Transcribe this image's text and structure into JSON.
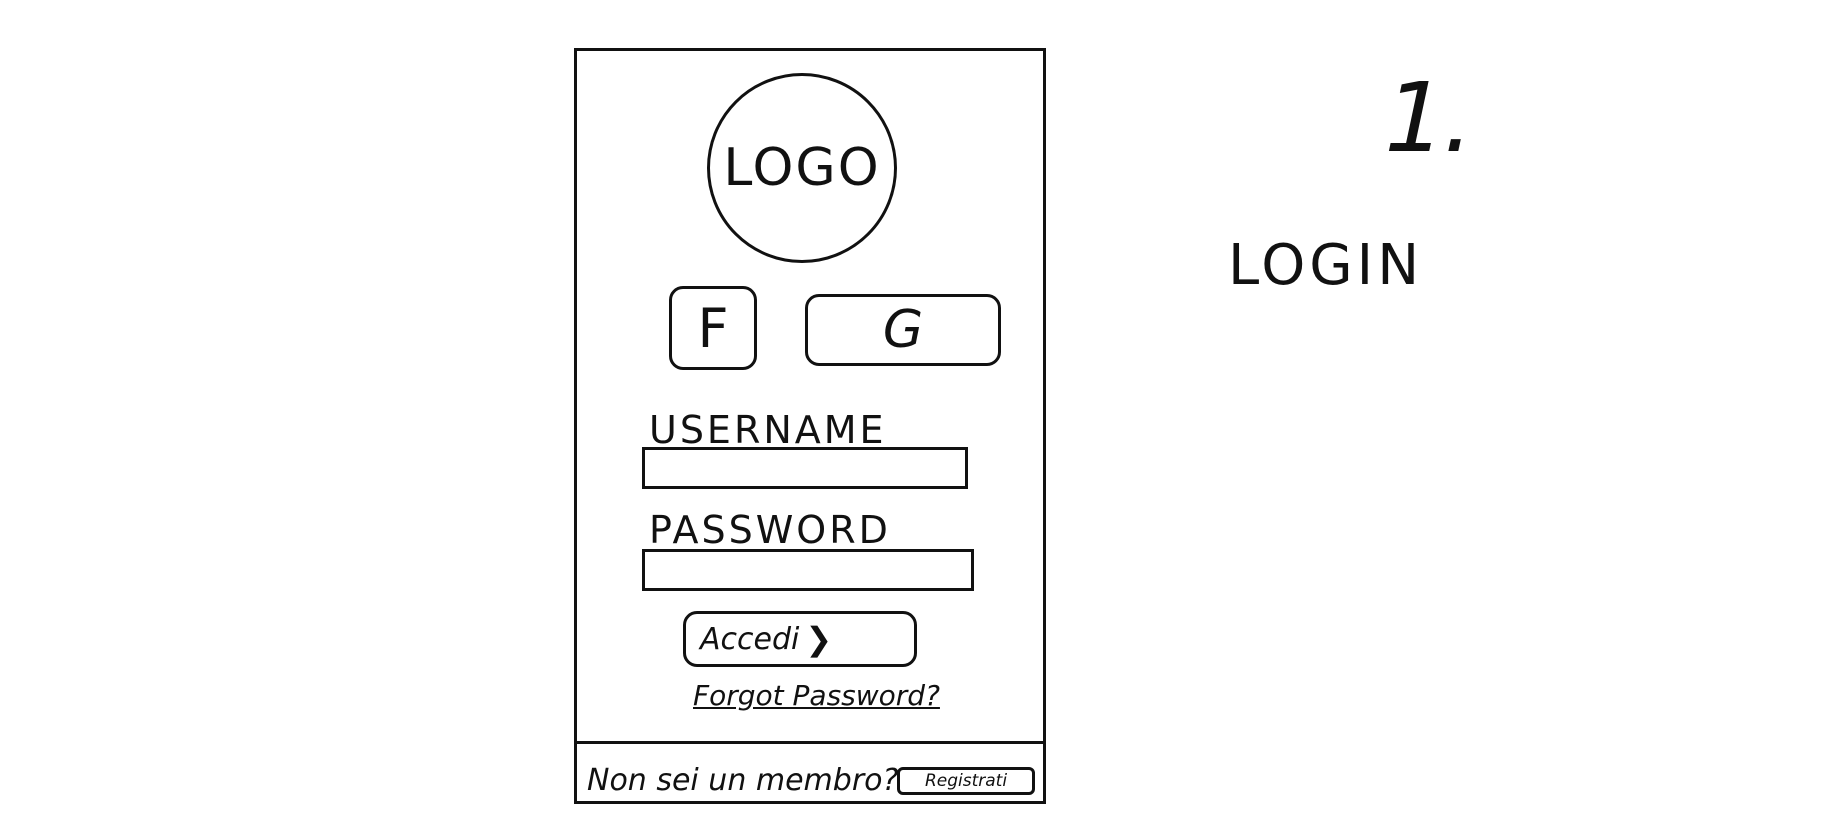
{
  "logo": {
    "label": "LOGO"
  },
  "social": {
    "facebook_label": "F",
    "google_label": "G"
  },
  "form": {
    "username_label": "USERNAME",
    "username_value": "",
    "password_label": "PASSWORD",
    "password_value": "",
    "submit_label": "Accedi",
    "submit_icon": "chevron-right-icon",
    "forgot_label": "Forgot Password?"
  },
  "footer": {
    "prompt": "Non sei un membro?",
    "register_label": "Registrati"
  },
  "annotation": {
    "screen_number": "1.",
    "screen_title": "LOGIN"
  }
}
